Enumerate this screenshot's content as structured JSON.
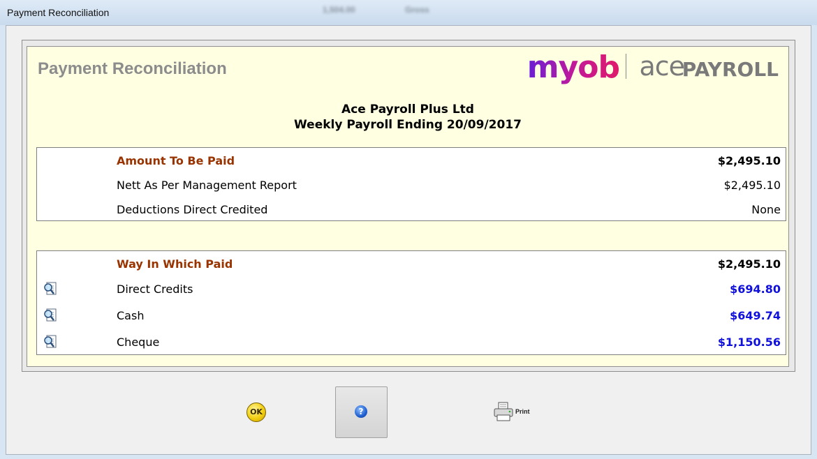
{
  "window": {
    "title": "Payment Reconciliation",
    "background_text": [
      "1,504.00",
      "Gross"
    ]
  },
  "header": {
    "heading": "Payment Reconciliation",
    "logo": {
      "brand": "myob",
      "product_a": "ace",
      "product_b": "PAYROLL"
    },
    "company": "Ace Payroll Plus Ltd",
    "period": "Weekly Payroll Ending 20/09/2017"
  },
  "amount_section": {
    "header_label": "Amount To Be Paid",
    "header_value": "$2,495.10",
    "rows": [
      {
        "label": "Nett As Per Management Report",
        "value": "$2,495.10"
      },
      {
        "label": "Deductions Direct Credited",
        "value": "None"
      }
    ]
  },
  "paid_section": {
    "header_label": "Way In Which Paid",
    "header_value": "$2,495.10",
    "rows": [
      {
        "label": "Direct Credits",
        "value": "$694.80",
        "icon": "magnifier-document-icon"
      },
      {
        "label": "Cash",
        "value": "$649.74",
        "icon": "magnifier-document-icon"
      },
      {
        "label": "Cheque",
        "value": "$1,150.56",
        "icon": "magnifier-document-icon"
      }
    ]
  },
  "buttons": {
    "ok_label": "OK",
    "help_label": "?",
    "print_label": "Print"
  },
  "colors": {
    "panel_bg": "#ffffe1",
    "section_header": "#993300",
    "link_value": "#1010dd"
  }
}
